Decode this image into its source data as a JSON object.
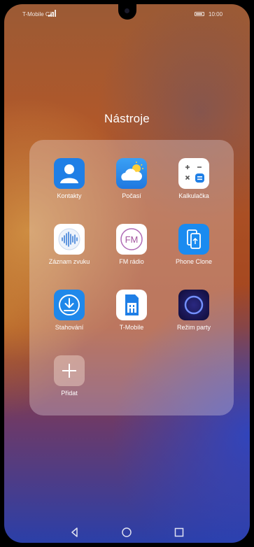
{
  "status_bar": {
    "carrier": "T-Mobile CZ",
    "time": "10:00"
  },
  "folder": {
    "title": "Nástroje",
    "apps": [
      {
        "label": "Kontakty",
        "icon": "contacts-icon"
      },
      {
        "label": "Počasí",
        "icon": "weather-icon"
      },
      {
        "label": "Kalkulačka",
        "icon": "calculator-icon"
      },
      {
        "label": "Záznam zvuku",
        "icon": "sound-recorder-icon"
      },
      {
        "label": "FM rádio",
        "icon": "fm-radio-icon"
      },
      {
        "label": "Phone Clone",
        "icon": "phone-clone-icon"
      },
      {
        "label": "Stahování",
        "icon": "downloads-icon"
      },
      {
        "label": "T-Mobile",
        "icon": "t-mobile-icon"
      },
      {
        "label": "Režim party",
        "icon": "party-mode-icon"
      },
      {
        "label": "Přidat",
        "icon": "add-icon"
      }
    ]
  },
  "fm_icon_text": "FM",
  "nav_bar": {
    "buttons": [
      "back-icon",
      "home-icon",
      "recents-icon"
    ]
  },
  "colors": {
    "contacts": "#1f7fe6",
    "weather": "#2a8ef0",
    "calculator_bg": "#ffffff",
    "phone_clone": "#1a8bf0",
    "downloads": "#1f88ea",
    "t_mobile_accent": "#1f7fe6",
    "party_mode": "#1c1a66",
    "add_tile": "rgba(230,200,190,0.55)"
  }
}
